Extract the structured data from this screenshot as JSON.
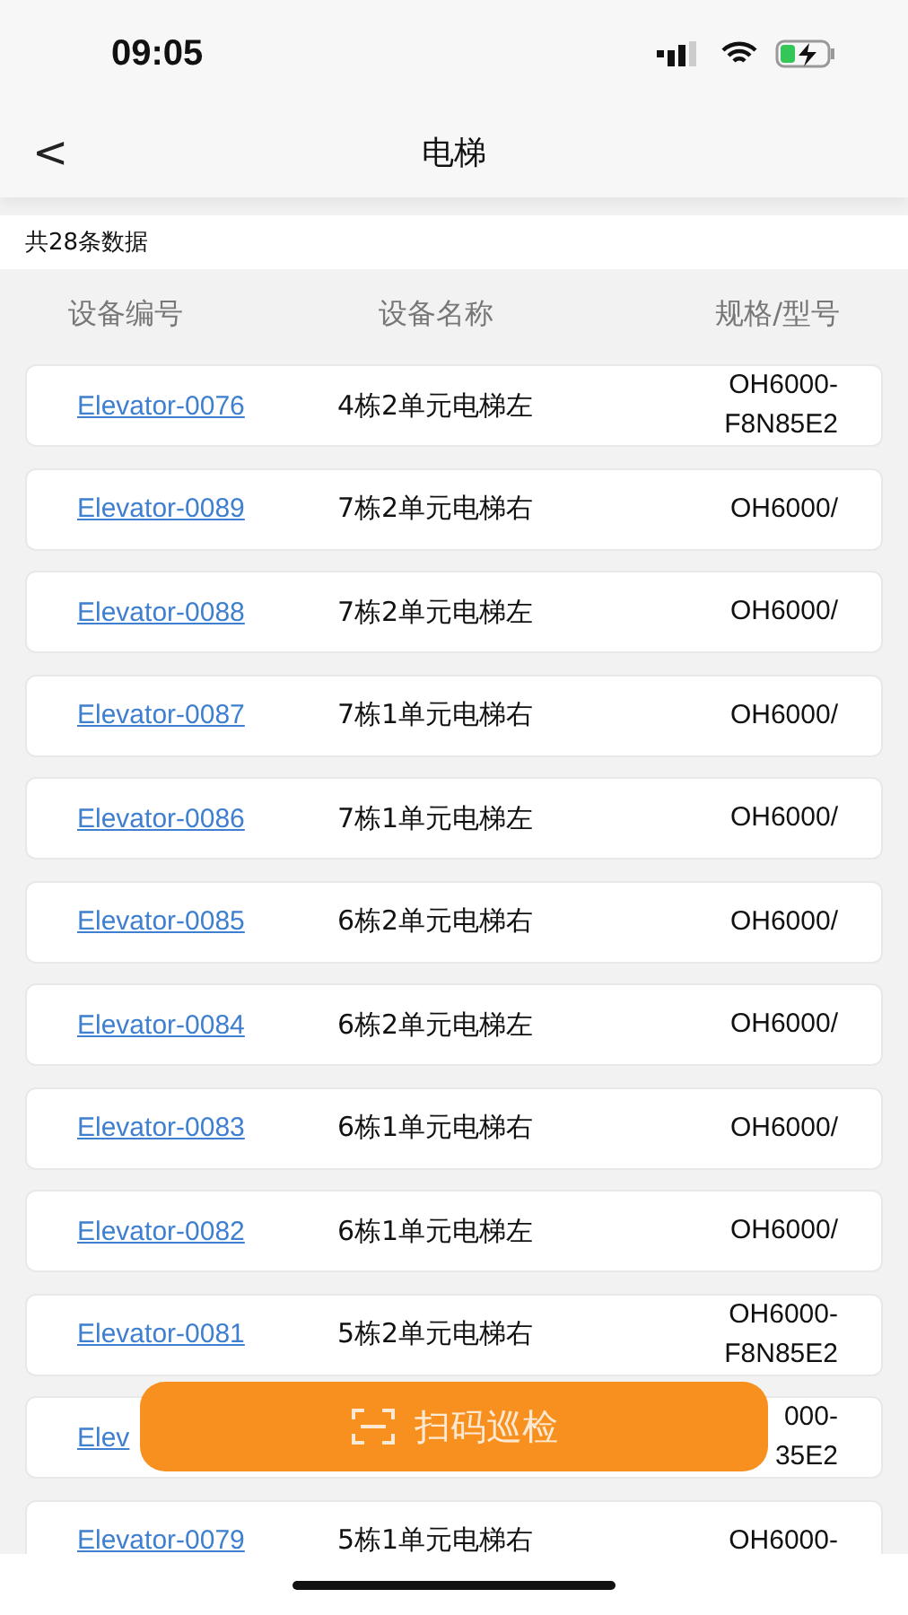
{
  "status_bar": {
    "time": "09:05"
  },
  "nav": {
    "back": "<",
    "title": "电梯"
  },
  "count": "共28条数据",
  "columns": [
    "设备编号",
    "设备名称",
    "规格/型号"
  ],
  "rows": [
    {
      "code": "Elevator-0076",
      "name": "4栋2单元电梯左",
      "spec_lines": [
        "OH6000-",
        "F8N85E2"
      ]
    },
    {
      "code": "Elevator-0089",
      "name": "7栋2单元电梯右",
      "spec_lines": [
        "OH6000/"
      ]
    },
    {
      "code": "Elevator-0088",
      "name": "7栋2单元电梯左",
      "spec_lines": [
        "OH6000/"
      ]
    },
    {
      "code": "Elevator-0087",
      "name": "7栋1单元电梯右",
      "spec_lines": [
        "OH6000/"
      ]
    },
    {
      "code": "Elevator-0086",
      "name": "7栋1单元电梯左",
      "spec_lines": [
        "OH6000/"
      ]
    },
    {
      "code": "Elevator-0085",
      "name": "6栋2单元电梯右",
      "spec_lines": [
        "OH6000/"
      ]
    },
    {
      "code": "Elevator-0084",
      "name": "6栋2单元电梯左",
      "spec_lines": [
        "OH6000/"
      ]
    },
    {
      "code": "Elevator-0083",
      "name": "6栋1单元电梯右",
      "spec_lines": [
        "OH6000/"
      ]
    },
    {
      "code": "Elevator-0082",
      "name": "6栋1单元电梯左",
      "spec_lines": [
        "OH6000/"
      ]
    },
    {
      "code": "Elevator-0081",
      "name": "5栋2单元电梯右",
      "spec_lines": [
        "OH6000-",
        "F8N85E2"
      ]
    },
    {
      "code": "Elev",
      "spec_lines": [
        "000-",
        "35E2"
      ]
    },
    {
      "code": "Elevator-0079",
      "name": "5栋1单元电梯右",
      "spec_lines": [
        "OH6000-"
      ]
    }
  ],
  "scan_button": {
    "label": "扫码巡检"
  }
}
